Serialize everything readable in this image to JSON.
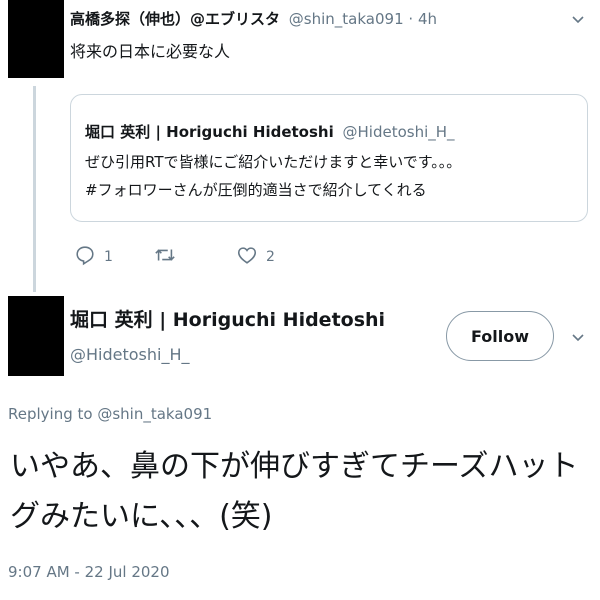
{
  "parent_tweet": {
    "author_name": "高橋多探（伸也）@エブリスタ",
    "author_handle": "@shin_taka091",
    "separator": "·",
    "time": "4h",
    "text": "将来の日本に必要な人",
    "quoted": {
      "author_name": "堀口 英利 | Horiguchi Hidetoshi",
      "author_handle": "@Hidetoshi_H_",
      "lines": [
        "ぜひ引用RTで皆様にご紹介いただけますと幸いです。。。",
        "#フォロワーさんが圧倒的適当さで紹介してくれる"
      ]
    },
    "actions": {
      "reply_count": "1",
      "retweet_count": "",
      "like_count": "2"
    }
  },
  "main_tweet": {
    "author_name": "堀口 英利 | Horiguchi Hidetoshi",
    "author_handle": "@Hidetoshi_H_",
    "follow_label": "Follow",
    "replying_prefix": "Replying to",
    "replying_handle": "@shin_taka091",
    "text": "いやあ、鼻の下が伸びすぎてチーズハットグみたいに、、、(笑)",
    "timestamp": "9:07 AM - 22 Jul 2020"
  },
  "colors": {
    "muted": "#657786",
    "border": "#ccd6dd",
    "text": "#14171a"
  },
  "icons": [
    "reply-icon",
    "retweet-icon",
    "like-icon",
    "chevron-down-icon"
  ]
}
